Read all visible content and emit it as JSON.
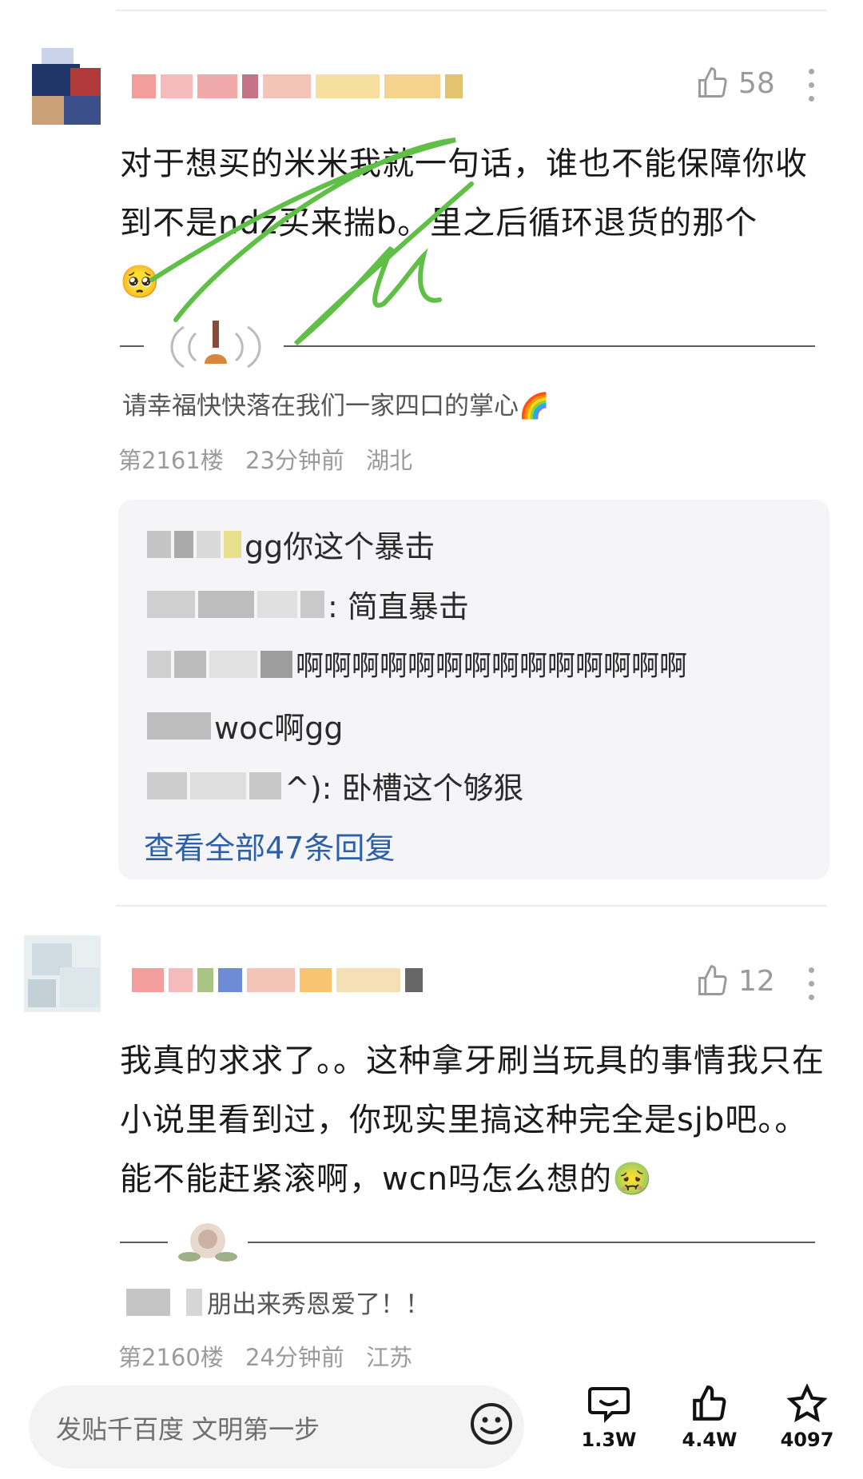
{
  "comments": [
    {
      "likes": "58",
      "text": "对于想买的米米我就一句话，谁也不能保障你收到不是ndz买来揣b。里之后循环退货的那个",
      "emoji": "🥺",
      "signature": "请幸福快快落在我们一家四口的掌心🌈",
      "floor": "第2161楼",
      "time": "23分钟前",
      "location": "湖北",
      "replies": [
        {
          "text": "gg你这个暴击"
        },
        {
          "text": ": 简直暴击"
        },
        {
          "text": "啊啊啊啊啊啊啊啊啊啊啊啊啊啊"
        },
        {
          "text": "woc啊gg"
        },
        {
          "text": "^): 卧槽这个够狠"
        }
      ],
      "view_all": "查看全部47条回复"
    },
    {
      "likes": "12",
      "text": "我真的求求了。。这种拿牙刷当玩具的事情我只在小说里看到过，你现实里搞这种完全是sjb吧。。能不能赶紧滚啊，wcn吗怎么想的",
      "emoji": "🤢",
      "signature": "朋出来秀恩爱了！！",
      "floor": "第2160楼",
      "time": "24分钟前",
      "location": "江苏"
    }
  ],
  "bottom_bar": {
    "input_placeholder": "发贴千百度 文明第一步",
    "actions": [
      {
        "icon": "comment-icon",
        "count": "1.3W"
      },
      {
        "icon": "thumbs-up-icon",
        "count": "4.4W"
      },
      {
        "icon": "star-icon",
        "count": "4097"
      }
    ]
  },
  "colors": {
    "link": "#2d5ea8",
    "meta": "#9b9b9b",
    "scribble": "#5fbf46"
  }
}
